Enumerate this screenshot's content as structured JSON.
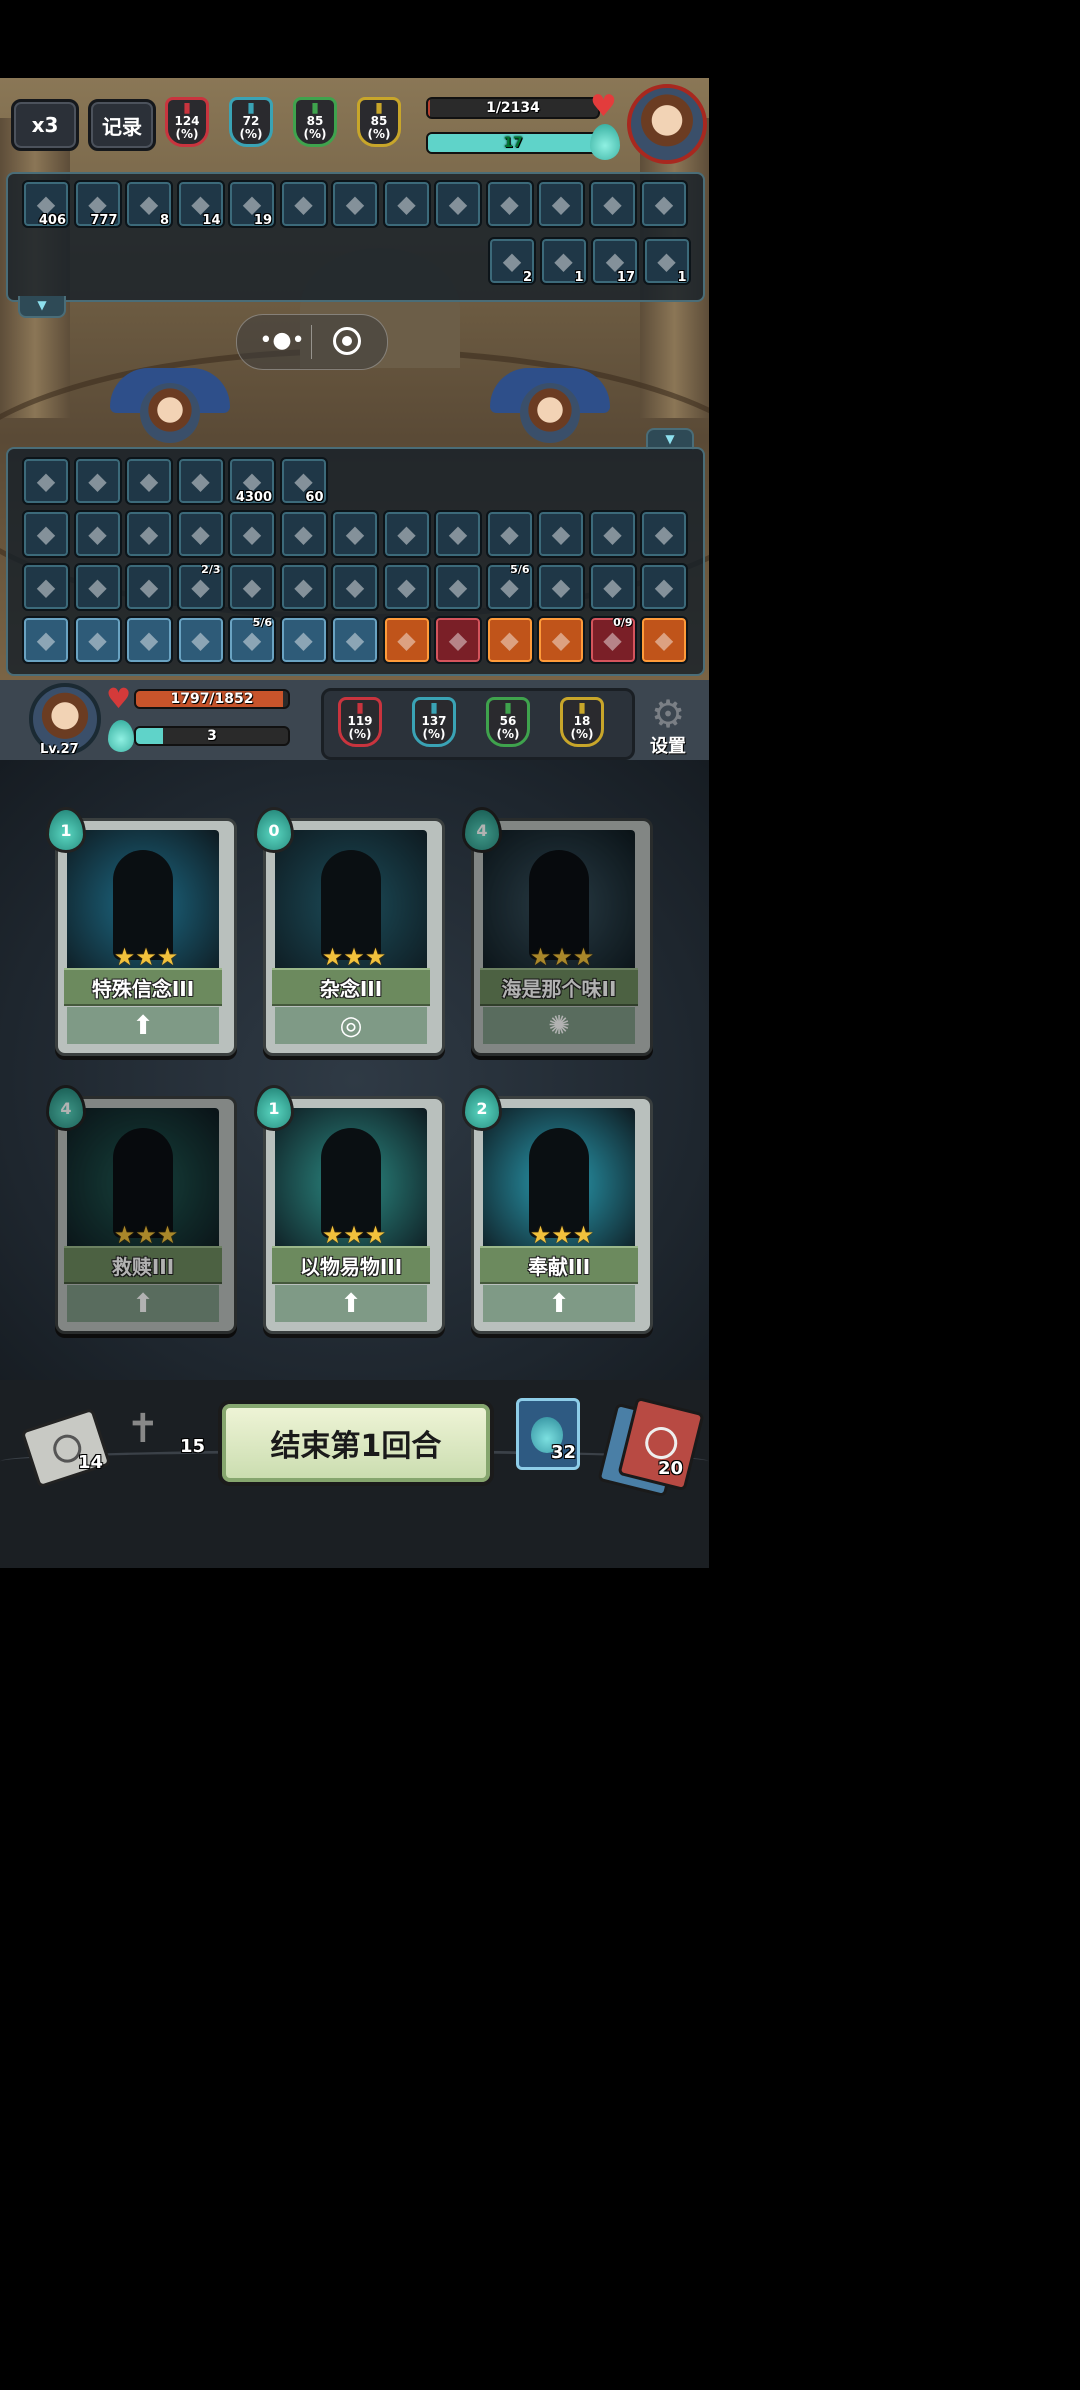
{
  "top": {
    "speed_label": "x3",
    "record_label": "记录",
    "enemy_stats": [
      {
        "icon": "red-sword-icon",
        "value": "124",
        "unit": "(%)",
        "color": "#c9343e"
      },
      {
        "icon": "blue-question-icon",
        "value": "72",
        "unit": "(%)",
        "color": "#3aa3b5"
      },
      {
        "icon": "green-pillar-icon",
        "value": "85",
        "unit": "(%)",
        "color": "#3fa34d"
      },
      {
        "icon": "gold-pillar-icon",
        "value": "85",
        "unit": "(%)",
        "color": "#c8a62a"
      }
    ],
    "enemy_hp": {
      "text": "1/2134",
      "fraction": 0.0005
    },
    "enemy_energy": {
      "text": "17",
      "fraction": 1.0
    }
  },
  "enemy_effects_row1": [
    {
      "icon": "skull-icon",
      "count": "406"
    },
    {
      "icon": "fire-icon",
      "count": "777"
    },
    {
      "icon": "vortex-icon",
      "count": "8"
    },
    {
      "icon": "purple-vortex-icon",
      "count": "14"
    },
    {
      "icon": "shield-icon",
      "count": "19"
    },
    {
      "icon": "dark-orb-icon",
      "count": ""
    },
    {
      "icon": "goblet-icon",
      "count": ""
    },
    {
      "icon": "mask-icon",
      "count": ""
    },
    {
      "icon": "bone-icon",
      "count": ""
    },
    {
      "icon": "trident-icon",
      "count": ""
    },
    {
      "icon": "bone-icon",
      "count": ""
    },
    {
      "icon": "sword-icon",
      "count": ""
    },
    {
      "icon": "feather-icon",
      "count": ""
    }
  ],
  "enemy_effects_row2": [
    {
      "icon": "sword-slash-icon",
      "count": "2"
    },
    {
      "icon": "flame-wall-icon",
      "count": "1"
    },
    {
      "icon": "green-snake-icon",
      "count": "17"
    },
    {
      "icon": "shield-icon",
      "count": "1"
    }
  ],
  "player_effects_top": [
    {
      "icon": "helmet-icon",
      "count": ""
    },
    {
      "icon": "boxing-glove-icon",
      "count": ""
    },
    {
      "icon": "vortex-icon",
      "count": ""
    },
    {
      "icon": "green-beam-icon",
      "count": ""
    },
    {
      "icon": "gold-flame-icon",
      "count": "4300"
    },
    {
      "icon": "shield-icon",
      "count": "60"
    }
  ],
  "relics_row1": [
    {
      "icon": "knight-helmet-icon"
    },
    {
      "icon": "red-demon-icon"
    },
    {
      "icon": "bandaged-head-icon"
    },
    {
      "icon": "sack-icon"
    },
    {
      "icon": "potion-icon"
    },
    {
      "icon": "coiled-rope-icon"
    },
    {
      "icon": "spiked-ball-icon"
    },
    {
      "icon": "cauldron-icon"
    },
    {
      "icon": "scroll-icon"
    },
    {
      "icon": "eyepatch-icon"
    },
    {
      "icon": "idol-icon"
    },
    {
      "icon": "dagger-icon"
    },
    {
      "icon": "red-bone-icon"
    }
  ],
  "relics_row2": [
    {
      "icon": "meat-icon",
      "top": ""
    },
    {
      "icon": "goblin-icon",
      "top": ""
    },
    {
      "icon": "crossbow-icon",
      "top": ""
    },
    {
      "icon": "slot-machine-icon",
      "top": "2/3"
    },
    {
      "icon": "red-glove-icon",
      "top": ""
    },
    {
      "icon": "bone-icon",
      "top": ""
    },
    {
      "icon": "rice-ball-icon",
      "top": ""
    },
    {
      "icon": "striped-mask-icon",
      "top": ""
    },
    {
      "icon": "cage-icon",
      "top": ""
    },
    {
      "icon": "scroll-icon",
      "top": "5/6"
    },
    {
      "icon": "amulet-icon",
      "top": ""
    },
    {
      "icon": "green-dice-icon",
      "top": ""
    },
    {
      "icon": "horn-icon",
      "top": ""
    }
  ],
  "relics_row3": [
    {
      "icon": "blue-rune-icon",
      "top": "",
      "tone": "blue"
    },
    {
      "icon": "blue-fist-icon",
      "top": "",
      "tone": "blue"
    },
    {
      "icon": "caduceus-icon",
      "top": "",
      "tone": "blue"
    },
    {
      "icon": "blue-face-icon",
      "top": "",
      "tone": "blue"
    },
    {
      "icon": "white-burst-icon",
      "top": "5/6",
      "tone": "blue"
    },
    {
      "icon": "pumpkin-icon",
      "top": "",
      "tone": "blue"
    },
    {
      "icon": "ogre-face-icon",
      "top": "",
      "tone": "blue"
    },
    {
      "icon": "boot-icon",
      "top": "",
      "tone": "orange"
    },
    {
      "icon": "boot-icon",
      "top": "",
      "tone": "red"
    },
    {
      "icon": "boot-icon",
      "top": "",
      "tone": "orange"
    },
    {
      "icon": "up-arrow-icon",
      "top": "",
      "tone": "orange"
    },
    {
      "icon": "heart-shield-icon",
      "top": "0/9",
      "tone": "red"
    },
    {
      "icon": "cycle-icon",
      "top": "",
      "tone": "orange"
    }
  ],
  "player": {
    "level": "Lv.27",
    "hp": {
      "text": "1797/1852",
      "fraction": 0.97
    },
    "energy": {
      "text": "3",
      "fraction": 0.18
    },
    "stats": [
      {
        "icon": "red-sword-icon",
        "value": "119",
        "unit": "(%)",
        "color": "#c9343e"
      },
      {
        "icon": "blue-question-icon",
        "value": "137",
        "unit": "(%)",
        "color": "#3aa3b5"
      },
      {
        "icon": "green-pillar-icon",
        "value": "56",
        "unit": "(%)",
        "color": "#3fa34d"
      },
      {
        "icon": "gold-pillar-icon",
        "value": "18",
        "unit": "(%)",
        "color": "#c8a62a"
      }
    ],
    "settings_label": "设置"
  },
  "cards": [
    {
      "name": "特殊信念III",
      "cost": "1",
      "stars": "★★★",
      "footer_icon": "up-arrow-icon",
      "art": "#1d6b86"
    },
    {
      "name": "杂念III",
      "cost": "0",
      "stars": "★★★",
      "footer_icon": "swirl-icon",
      "art": "#1c4d5a"
    },
    {
      "name": "海是那个味II",
      "cost": "4",
      "stars": "★★★",
      "footer_icon": "wisp-icon",
      "art": "#3a5563"
    },
    {
      "name": "救赎III",
      "cost": "4",
      "stars": "★★★",
      "footer_icon": "up-arrow-icon",
      "art": "#1f5d55"
    },
    {
      "name": "以物易物III",
      "cost": "1",
      "stars": "★★★",
      "footer_icon": "up-arrow-icon",
      "art": "#2c8d85"
    },
    {
      "name": "奉献III",
      "cost": "2",
      "stars": "★★★",
      "footer_icon": "up-arrow-icon",
      "art": "#2a9fb4"
    }
  ],
  "bottom": {
    "end_turn_label": "结束第1回合",
    "discard_count": "14",
    "grave_count": "15",
    "potion_count": "32",
    "draw_count": "20"
  }
}
